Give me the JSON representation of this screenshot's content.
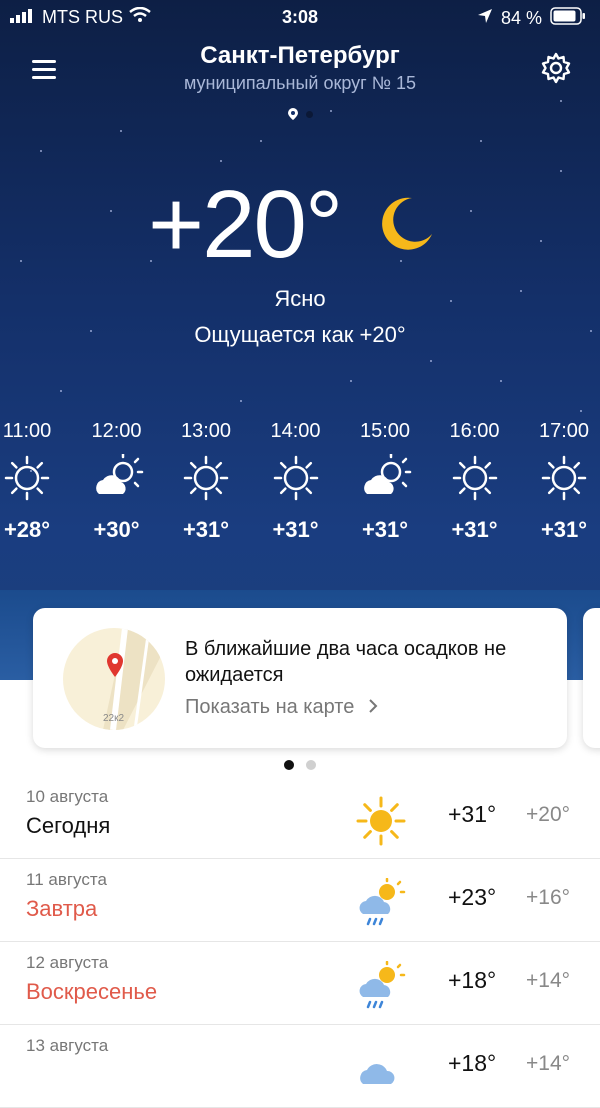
{
  "status": {
    "carrier": "MTS RUS",
    "time": "3:08",
    "battery": "84 %"
  },
  "header": {
    "city": "Санкт-Петербург",
    "district": "муниципальный округ № 15"
  },
  "current": {
    "temp": "+20°",
    "condition": "Ясно",
    "feels_like": "Ощущается как +20°"
  },
  "hourly": [
    {
      "time": "11:00",
      "temp": "+28°",
      "icon": "sun-icon"
    },
    {
      "time": "12:00",
      "temp": "+30°",
      "icon": "partly-cloudy-icon"
    },
    {
      "time": "13:00",
      "temp": "+31°",
      "icon": "sun-icon"
    },
    {
      "time": "14:00",
      "temp": "+31°",
      "icon": "sun-icon"
    },
    {
      "time": "15:00",
      "temp": "+31°",
      "icon": "partly-cloudy-icon"
    },
    {
      "time": "16:00",
      "temp": "+31°",
      "icon": "sun-icon"
    },
    {
      "time": "17:00",
      "temp": "+31°",
      "icon": "sun-icon"
    }
  ],
  "nowcast": {
    "message": "В ближайшие два часа осадков не ожидается",
    "link": "Показать на карте",
    "map_label": "22к2"
  },
  "daily": [
    {
      "date": "10 августа",
      "name": "Сегодня",
      "hi": "+31°",
      "lo": "+20°",
      "icon": "sun-icon"
    },
    {
      "date": "11 августа",
      "name": "Завтра",
      "hi": "+23°",
      "lo": "+16°",
      "icon": "rain-sun-icon"
    },
    {
      "date": "12 августа",
      "name": "Воскресенье",
      "hi": "+18°",
      "lo": "+14°",
      "icon": "rain-sun-icon"
    },
    {
      "date": "13 августа",
      "name": "",
      "hi": "+18°",
      "lo": "+14°",
      "icon": "cloud-icon"
    }
  ],
  "colors": {
    "sky": "#14306a",
    "sun": "#f6b81a",
    "weekend": "#e05a4a"
  }
}
